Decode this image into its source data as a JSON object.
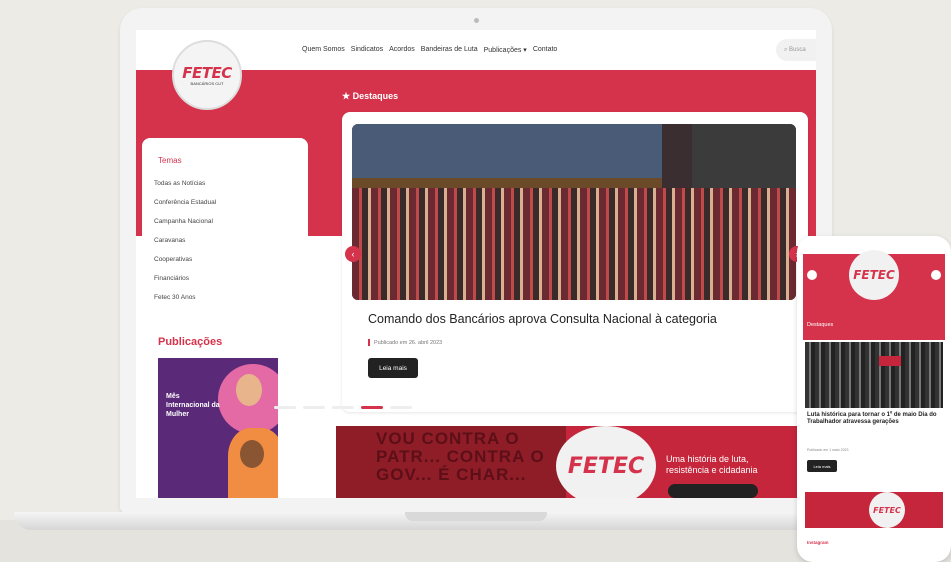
{
  "site": {
    "logo_text": "FETEC",
    "logo_subtext": "BANCÁRIOS CUT"
  },
  "nav": [
    "Quem Somos",
    "Sindicatos",
    "Acordos",
    "Bandeiras de Luta",
    "Publicações ▾",
    "Contato"
  ],
  "search": {
    "placeholder": "Busca"
  },
  "highlights": {
    "title": "★ Destaques"
  },
  "sidebar": {
    "topics_title": "Temas",
    "topics": [
      "Todas as Notícias",
      "Conferência Estadual",
      "Campanha Nacional",
      "Caravanas",
      "Cooperativas",
      "Financiários",
      "Fetec 30 Anos"
    ],
    "publications_title": "Publicações",
    "publication_cover_text": "Mês Internacional da Mulher"
  },
  "featured": {
    "headline": "Comando dos Bancários aprova Consulta Nacional à categoria",
    "date": "Publicado em 26. abril 2023",
    "read_more": "Leia mais"
  },
  "banner": {
    "slogan": "VOU CONTRA O PATR... CONTRA O GOV... É CHAR...",
    "logo_text": "FETEC",
    "logo_subtext": "BANCÁRIOS CUT",
    "tagline": "Uma história de luta, resistência e cidadania"
  },
  "phone": {
    "logo_text": "FETEC",
    "highlights_title": "Destaques",
    "headline": "Luta histórica para tornar o 1º de maio Dia do Trabalhador atravessa gerações",
    "date": "Publicado em 1 maio 2023",
    "read_more": "Leia mais",
    "banner_logo_text": "FETEC",
    "instagram_title": "Instagram"
  },
  "colors": {
    "brand": "#d5334b",
    "dark": "#222222"
  }
}
